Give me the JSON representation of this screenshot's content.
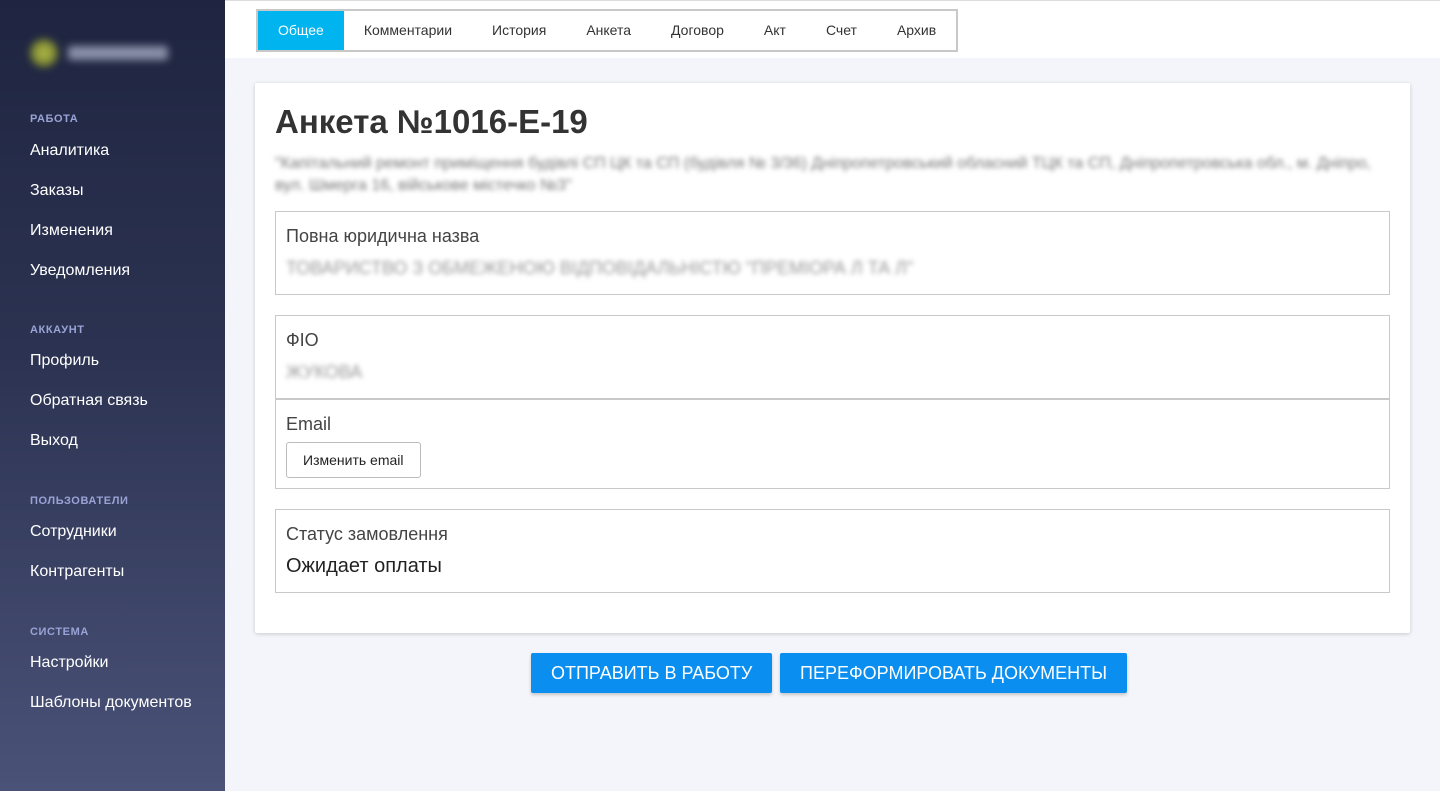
{
  "sidebar": {
    "sections": [
      {
        "heading": "РАБОТА",
        "items": [
          "Аналитика",
          "Заказы",
          "Изменения",
          "Уведомления"
        ]
      },
      {
        "heading": "АККАУНТ",
        "items": [
          "Профиль",
          "Обратная связь",
          "Выход"
        ]
      },
      {
        "heading": "ПОЛЬЗОВАТЕЛИ",
        "items": [
          "Сотрудники",
          "Контрагенты"
        ]
      },
      {
        "heading": "СИСТЕМА",
        "items": [
          "Настройки",
          "Шаблоны документов"
        ]
      }
    ]
  },
  "tabs": [
    "Общее",
    "Комментарии",
    "История",
    "Анкета",
    "Договор",
    "Акт",
    "Счет",
    "Архив"
  ],
  "active_tab": "Общее",
  "card": {
    "title": "Анкета №1016-Е-19",
    "subtitle": "\"Капітальний ремонт приміщення будівлі СП ЦК та СП (будівля № 3/36) Дніпропетровський обласний ТЦК та СП, Дніпропетровська обл., м. Дніпро, вул. Шмерга 16, військове містечко №3\"",
    "legal_name": {
      "label": "Повна юридична назва",
      "value": "ТОВАРИСТВО З ОБМЕЖЕНОЮ ВІДПОВІДАЛЬНІСТЮ \"ПРЕМІОРА Л ТА Л\""
    },
    "fio": {
      "label": "ФІО",
      "value": "ЖУКОВА"
    },
    "email": {
      "label": "Email",
      "button": "Изменить email"
    },
    "status": {
      "label": "Статус замовлення",
      "value": "Ожидает оплаты"
    }
  },
  "actions": {
    "send": "Отправить в работу",
    "regenerate": "Переформировать документы"
  },
  "colors": {
    "accent": "#00b4f0",
    "button": "#0a8ef0",
    "sidebar_top": "#1f2540",
    "sidebar_bottom": "#4a5278"
  }
}
